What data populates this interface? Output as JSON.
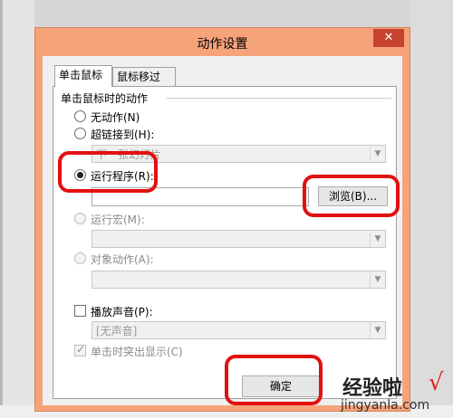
{
  "dialog": {
    "title": "动作设置",
    "close_label": "✕",
    "tabs": [
      {
        "label": "单击鼠标",
        "active": true
      },
      {
        "label": "鼠标移过",
        "active": false
      }
    ],
    "group_label": "单击鼠标时的动作",
    "options": {
      "none": {
        "label": "无动作(N)",
        "checked": false
      },
      "hyperlink": {
        "label": "超链接到(H):",
        "checked": false,
        "value": "下一张幻灯片"
      },
      "run_program": {
        "label": "运行程序(R):",
        "checked": true,
        "value": ""
      },
      "browse_label": "浏览(B)...",
      "run_macro": {
        "label": "运行宏(M):",
        "checked": false,
        "disabled": true,
        "value": ""
      },
      "object_action": {
        "label": "对象动作(A):",
        "checked": false,
        "disabled": true,
        "value": ""
      }
    },
    "play_sound": {
      "label": "播放声音(P):",
      "checked": false,
      "value": "[无声音]"
    },
    "highlight": {
      "label": "单击时突出显示(C)",
      "checked": true,
      "disabled": true
    },
    "ok_label": "确定"
  },
  "watermark": {
    "main": "经验啦",
    "check": "√",
    "sub": "jingyanla.com"
  },
  "colors": {
    "titlebar": "#f7a37a",
    "close_button": "#c7432f",
    "annotation": "#e21111"
  },
  "icons": [
    "close-icon",
    "chevron-down-icon",
    "check-icon"
  ]
}
